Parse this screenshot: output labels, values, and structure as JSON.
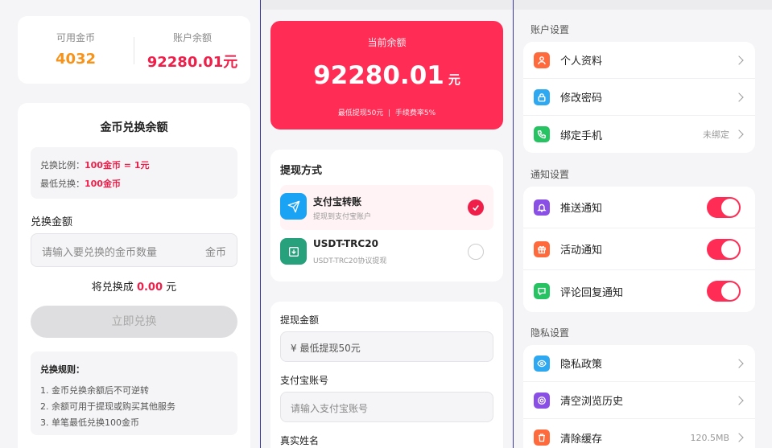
{
  "panel1": {
    "coins_label": "可用金币",
    "coins_value": "4032",
    "balance_label": "账户余额",
    "balance_value": "92280.01元",
    "exchange_title": "金币兑换余额",
    "ratio_label": "兑换比例：",
    "ratio_value": "100金币 = 1元",
    "min_label": "最低兑换：",
    "min_value": "100金币",
    "amount_label": "兑换金额",
    "amount_placeholder": "请输入要兑换的金币数量",
    "amount_unit": "金币",
    "result_prefix": "将兑换成",
    "result_value": "0.00",
    "result_unit": "元",
    "button": "立即兑换",
    "rules_title": "兑换规则：",
    "rules": [
      "1. 金币兑换余额后不可逆转",
      "2. 余额可用于提现或购买其他服务",
      "3. 单笔最低兑换100金币"
    ],
    "colors": {
      "coins": "#f7931a",
      "balance": "#ef1f4a"
    }
  },
  "panel2": {
    "hero_title": "当前余额",
    "hero_amount": "92280.01",
    "hero_unit": "元",
    "hero_min": "最低提现50元",
    "hero_sep": "|",
    "hero_fee": "手续费率5%",
    "method_title": "提现方式",
    "methods": [
      {
        "name": "支付宝转账",
        "desc": "提现到支付宝账户",
        "icon": "send-icon",
        "selected": true
      },
      {
        "name": "USDT-TRC20",
        "desc": "USDT-TRC20协议提现",
        "icon": "download-icon",
        "selected": false
      }
    ],
    "amount_label": "提现金额",
    "amount_placeholder": "¥ 最低提现50元",
    "account_label": "支付宝账号",
    "account_placeholder": "请输入支付宝账号",
    "name_label": "真实姓名",
    "colors": {
      "accent": "#ff2d55",
      "alipay": "#1aa3f5",
      "usdt": "#26a17b"
    }
  },
  "panel3": {
    "account_section": "账户设置",
    "account_items": [
      {
        "label": "个人资料",
        "value": "",
        "icon": "user-icon",
        "color": "#ff6a3d"
      },
      {
        "label": "修改密码",
        "value": "",
        "icon": "lock-icon",
        "color": "#2ea8f0"
      },
      {
        "label": "绑定手机",
        "value": "未绑定",
        "icon": "phone-icon",
        "color": "#27c262"
      }
    ],
    "notify_section": "通知设置",
    "notify_items": [
      {
        "label": "推送通知",
        "icon": "bell-icon",
        "color": "#8a50e6",
        "on": true
      },
      {
        "label": "活动通知",
        "icon": "gift-icon",
        "color": "#ff6a3d",
        "on": true
      },
      {
        "label": "评论回复通知",
        "icon": "comment-icon",
        "color": "#27c262",
        "on": true
      }
    ],
    "privacy_section": "隐私设置",
    "privacy_items": [
      {
        "label": "隐私政策",
        "value": "",
        "icon": "eye-icon",
        "color": "#2ea8f0"
      },
      {
        "label": "清空浏览历史",
        "value": "",
        "icon": "history-icon",
        "color": "#8a50e6"
      },
      {
        "label": "清除缓存",
        "value": "120.5MB",
        "icon": "trash-icon",
        "color": "#ff6a3d"
      }
    ]
  }
}
